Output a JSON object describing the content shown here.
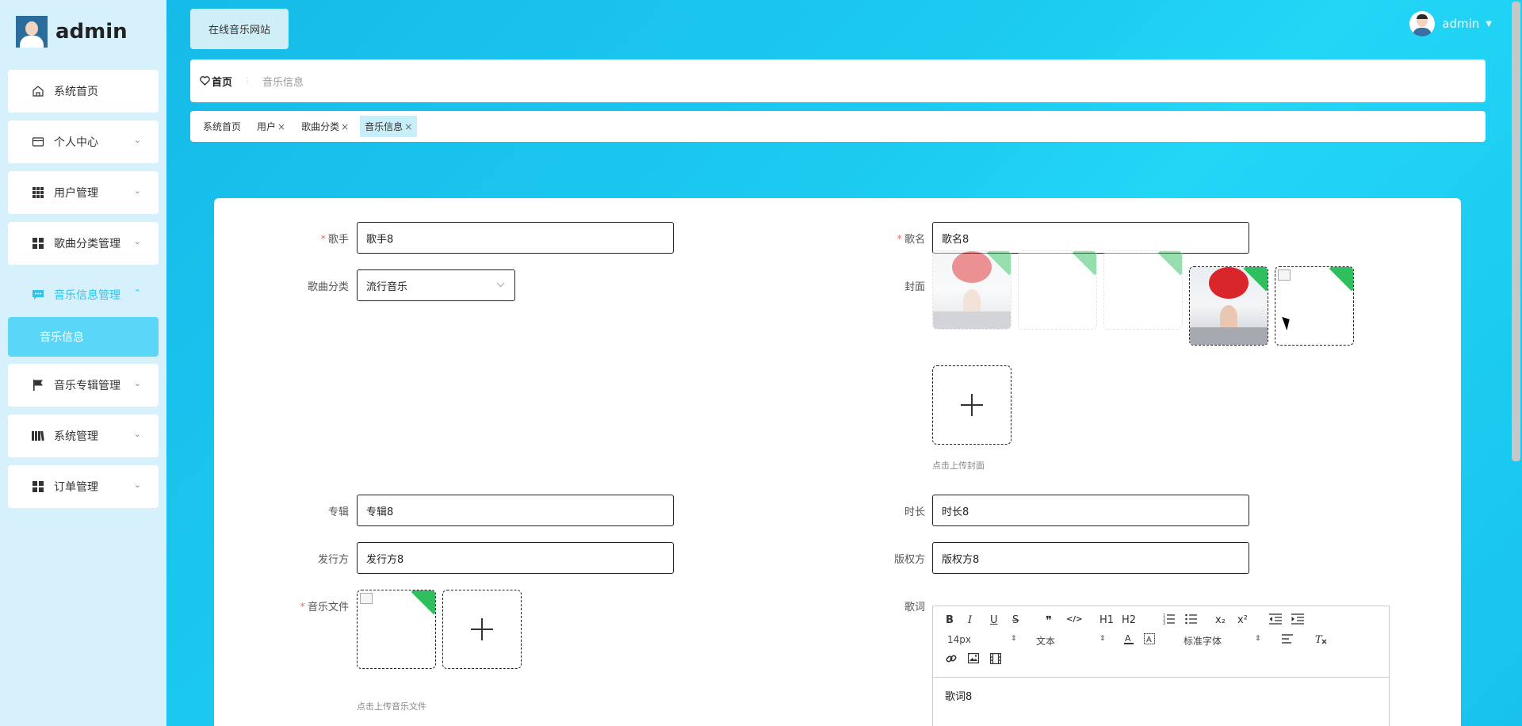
{
  "brand": {
    "name": "admin",
    "avatar_icon": "admin-avatar"
  },
  "header": {
    "site_button": "在线音乐网站",
    "user": "admin",
    "user_caret": "▼"
  },
  "breadcrumb": {
    "home": "首页",
    "current": "音乐信息",
    "separator": "⋮"
  },
  "tabs": [
    {
      "label": "系统首页",
      "closable": false
    },
    {
      "label": "用户",
      "closable": true
    },
    {
      "label": "歌曲分类",
      "closable": true
    },
    {
      "label": "音乐信息",
      "closable": true,
      "active": true
    }
  ],
  "tab_close": "×",
  "sidebar": {
    "items": [
      {
        "label": "系统首页",
        "icon": "home-icon"
      },
      {
        "label": "个人中心",
        "icon": "card-icon",
        "chevron": "⌄"
      },
      {
        "label": "用户管理",
        "icon": "grid-icon",
        "chevron": "⌄"
      },
      {
        "label": "歌曲分类管理",
        "icon": "apps-icon",
        "chevron": "⌄"
      },
      {
        "label": "音乐信息管理",
        "icon": "message-icon",
        "chevron": "⌃",
        "active": true
      },
      {
        "label": "音乐专辑管理",
        "icon": "flag-icon",
        "chevron": "⌄"
      },
      {
        "label": "系统管理",
        "icon": "book-icon",
        "chevron": "⌄"
      },
      {
        "label": "订单管理",
        "icon": "apps-icon",
        "chevron": "⌄"
      }
    ],
    "submenu": {
      "label": "音乐信息"
    }
  },
  "form": {
    "required_mark": "*",
    "singer": {
      "label": "歌手",
      "value": "歌手8"
    },
    "song_name": {
      "label": "歌名",
      "value": "歌名8"
    },
    "category": {
      "label": "歌曲分类",
      "value": "流行音乐"
    },
    "cover": {
      "label": "封面",
      "hint": "点击上传封面"
    },
    "album": {
      "label": "专辑",
      "value": "专辑8"
    },
    "duration": {
      "label": "时长",
      "value": "时长8"
    },
    "publisher": {
      "label": "发行方",
      "value": "发行方8"
    },
    "copyright": {
      "label": "版权方",
      "value": "版权方8"
    },
    "music_file": {
      "label": "音乐文件",
      "hint": "点击上传音乐文件"
    },
    "lyrics": {
      "label": "歌词",
      "value": "歌词8"
    }
  },
  "editor_toolbar": {
    "bold": "B",
    "italic": "I",
    "underline": "U",
    "strike": "S",
    "quote": "❞",
    "code": "</>",
    "h1": "H1",
    "h2": "H2",
    "sub": "x₂",
    "sup": "x²",
    "size": "14px",
    "format": "文本",
    "font": "标准字体",
    "updown": "⇕"
  },
  "colors": {
    "accent": "#2ec4f0",
    "required": "#f56c6c",
    "corner_green": "#2fbf5f"
  }
}
